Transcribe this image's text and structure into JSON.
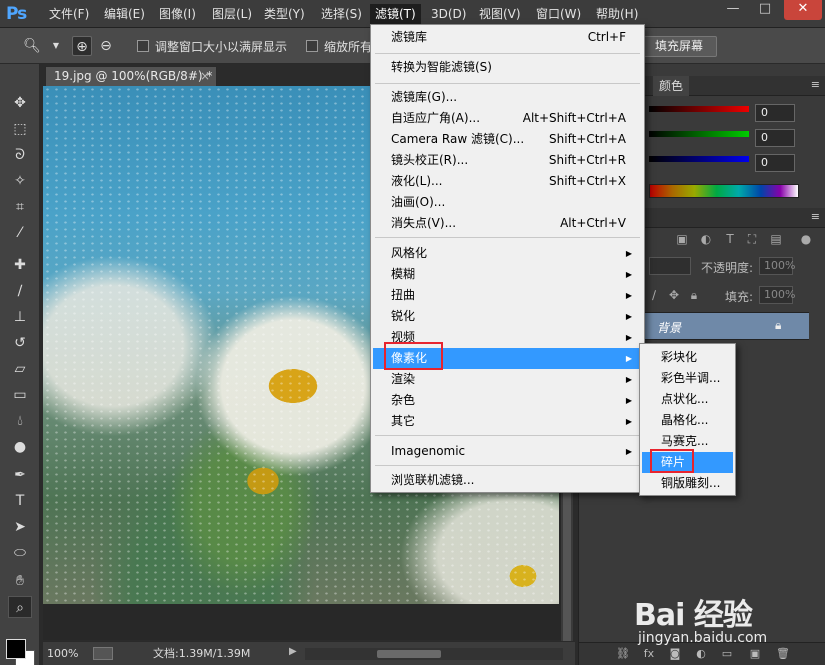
{
  "app": {
    "logo": "Ps"
  },
  "menubar": {
    "items": [
      "文件(F)",
      "编辑(E)",
      "图像(I)",
      "图层(L)",
      "类型(Y)",
      "选择(S)",
      "滤镜(T)",
      "3D(D)",
      "视图(V)",
      "窗口(W)",
      "帮助(H)"
    ],
    "active": "滤镜(T)"
  },
  "window_controls": {
    "minimize": "—",
    "restore": "□",
    "close": "✕"
  },
  "options_bar": {
    "resize_windows_label": "调整窗口大小以满屏显示",
    "zoom_all_label": "缩放所有",
    "fill_screen_button": "填充屏幕"
  },
  "document": {
    "tab_title": "19.jpg @ 100%(RGB/8#) *",
    "tab_close": "×",
    "zoom": "100%",
    "doc_size": "文档:1.39M/1.39M"
  },
  "color_panel": {
    "tab": "颜色",
    "r": "0",
    "g": "0",
    "b": "0"
  },
  "layers_panel": {
    "opacity_label": "不透明度:",
    "opacity_value": "100%",
    "fill_label": "填充:",
    "fill_value": "100%",
    "layer_name": "背景"
  },
  "filter_menu": {
    "items": [
      {
        "label": "滤镜库",
        "shortcut": "Ctrl+F"
      },
      {
        "label": "转换为智能滤镜(S)",
        "shortcut": ""
      },
      {
        "label": "滤镜库(G)...",
        "shortcut": ""
      },
      {
        "label": "自适应广角(A)...",
        "shortcut": "Alt+Shift+Ctrl+A"
      },
      {
        "label": "Camera Raw 滤镜(C)...",
        "shortcut": "Shift+Ctrl+A"
      },
      {
        "label": "镜头校正(R)...",
        "shortcut": "Shift+Ctrl+R"
      },
      {
        "label": "液化(L)...",
        "shortcut": "Shift+Ctrl+X"
      },
      {
        "label": "油画(O)...",
        "shortcut": ""
      },
      {
        "label": "消失点(V)...",
        "shortcut": "Alt+Ctrl+V"
      },
      {
        "label": "风格化",
        "shortcut": ""
      },
      {
        "label": "模糊",
        "shortcut": ""
      },
      {
        "label": "扭曲",
        "shortcut": ""
      },
      {
        "label": "锐化",
        "shortcut": ""
      },
      {
        "label": "视频",
        "shortcut": ""
      },
      {
        "label": "像素化",
        "shortcut": ""
      },
      {
        "label": "渲染",
        "shortcut": ""
      },
      {
        "label": "杂色",
        "shortcut": ""
      },
      {
        "label": "其它",
        "shortcut": ""
      },
      {
        "label": "Imagenomic",
        "shortcut": ""
      },
      {
        "label": "浏览联机滤镜...",
        "shortcut": ""
      }
    ],
    "highlighted": "像素化"
  },
  "pixelate_submenu": {
    "items": [
      "彩块化",
      "彩色半调...",
      "点状化...",
      "晶格化...",
      "马赛克...",
      "碎片",
      "铜版雕刻..."
    ],
    "highlighted": "碎片"
  },
  "watermark": {
    "brand": "Bai 经验",
    "url": "jingyan.baidu.com"
  },
  "colors": {
    "accent": "#3399ff",
    "annotation": "#e8242e",
    "layer_selected": "#6f89a8"
  }
}
